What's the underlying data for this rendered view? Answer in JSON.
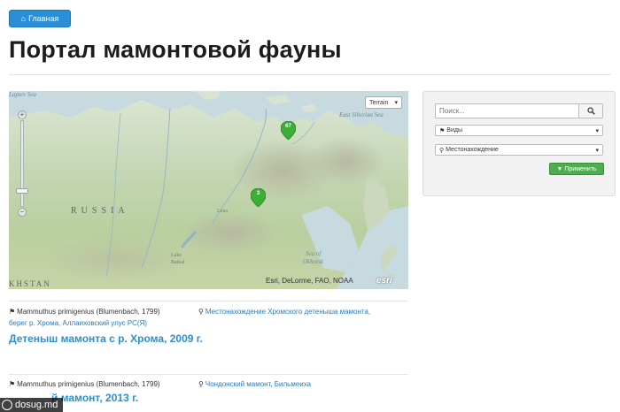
{
  "nav": {
    "home_label": "Главная",
    "home_icon": "home-icon"
  },
  "page": {
    "title": "Портал мамонтовой фауны"
  },
  "map": {
    "basemap_select": "Terrain",
    "labels": {
      "laptev_sea": "Laptev Sea",
      "east_siberian_sea": "East Siberian Sea",
      "russia": "RUSSIA",
      "lena": "Lena",
      "lake_baikal_1": "Lake",
      "lake_baikal_2": "Baikal",
      "sea_of_okhotsk_1": "Sea of",
      "sea_of_okhotsk_2": "Okhotsk",
      "kazakhstan": "KHSTAN"
    },
    "markers": [
      {
        "count": "67",
        "color": "#3cb034"
      },
      {
        "count": "3",
        "color": "#3cb034"
      }
    ],
    "attribution": "Esri, DeLorme, FAO, NOAA",
    "esri_logo": "esri"
  },
  "filters": {
    "search_placeholder": "Поиск...",
    "species_select": "Виды",
    "location_select": "Местонахождение",
    "apply_label": "Применить",
    "accent": "#4cae4c"
  },
  "entries": [
    {
      "species": "Mammuthus primigenius (Blumenbach, 1799)",
      "location_line1": "Местонахождение Хромского детеныша мамонта,",
      "location_line2": "берег р. Хрома, Аллаиховский улус РС(Я)",
      "title": "Детеныш мамонта с р. Хрома, 2009 г."
    },
    {
      "species": "Mammuthus primigenius (Blumenbach, 1799)",
      "location_line1": "Чондонский мамонт, Бильмеиха",
      "title": "й мамонт, 2013 г."
    }
  ],
  "watermark": {
    "text": "dosug.md"
  }
}
